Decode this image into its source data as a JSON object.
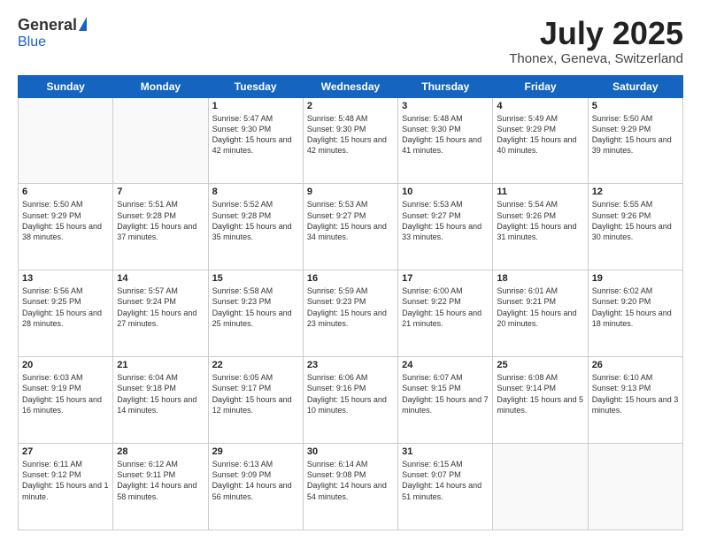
{
  "header": {
    "logo_general": "General",
    "logo_blue": "Blue",
    "title": "July 2025",
    "location": "Thonex, Geneva, Switzerland"
  },
  "days_of_week": [
    "Sunday",
    "Monday",
    "Tuesday",
    "Wednesday",
    "Thursday",
    "Friday",
    "Saturday"
  ],
  "weeks": [
    [
      {
        "day": "",
        "detail": ""
      },
      {
        "day": "",
        "detail": ""
      },
      {
        "day": "1",
        "detail": "Sunrise: 5:47 AM\nSunset: 9:30 PM\nDaylight: 15 hours\nand 42 minutes."
      },
      {
        "day": "2",
        "detail": "Sunrise: 5:48 AM\nSunset: 9:30 PM\nDaylight: 15 hours\nand 42 minutes."
      },
      {
        "day": "3",
        "detail": "Sunrise: 5:48 AM\nSunset: 9:30 PM\nDaylight: 15 hours\nand 41 minutes."
      },
      {
        "day": "4",
        "detail": "Sunrise: 5:49 AM\nSunset: 9:29 PM\nDaylight: 15 hours\nand 40 minutes."
      },
      {
        "day": "5",
        "detail": "Sunrise: 5:50 AM\nSunset: 9:29 PM\nDaylight: 15 hours\nand 39 minutes."
      }
    ],
    [
      {
        "day": "6",
        "detail": "Sunrise: 5:50 AM\nSunset: 9:29 PM\nDaylight: 15 hours\nand 38 minutes."
      },
      {
        "day": "7",
        "detail": "Sunrise: 5:51 AM\nSunset: 9:28 PM\nDaylight: 15 hours\nand 37 minutes."
      },
      {
        "day": "8",
        "detail": "Sunrise: 5:52 AM\nSunset: 9:28 PM\nDaylight: 15 hours\nand 35 minutes."
      },
      {
        "day": "9",
        "detail": "Sunrise: 5:53 AM\nSunset: 9:27 PM\nDaylight: 15 hours\nand 34 minutes."
      },
      {
        "day": "10",
        "detail": "Sunrise: 5:53 AM\nSunset: 9:27 PM\nDaylight: 15 hours\nand 33 minutes."
      },
      {
        "day": "11",
        "detail": "Sunrise: 5:54 AM\nSunset: 9:26 PM\nDaylight: 15 hours\nand 31 minutes."
      },
      {
        "day": "12",
        "detail": "Sunrise: 5:55 AM\nSunset: 9:26 PM\nDaylight: 15 hours\nand 30 minutes."
      }
    ],
    [
      {
        "day": "13",
        "detail": "Sunrise: 5:56 AM\nSunset: 9:25 PM\nDaylight: 15 hours\nand 28 minutes."
      },
      {
        "day": "14",
        "detail": "Sunrise: 5:57 AM\nSunset: 9:24 PM\nDaylight: 15 hours\nand 27 minutes."
      },
      {
        "day": "15",
        "detail": "Sunrise: 5:58 AM\nSunset: 9:23 PM\nDaylight: 15 hours\nand 25 minutes."
      },
      {
        "day": "16",
        "detail": "Sunrise: 5:59 AM\nSunset: 9:23 PM\nDaylight: 15 hours\nand 23 minutes."
      },
      {
        "day": "17",
        "detail": "Sunrise: 6:00 AM\nSunset: 9:22 PM\nDaylight: 15 hours\nand 21 minutes."
      },
      {
        "day": "18",
        "detail": "Sunrise: 6:01 AM\nSunset: 9:21 PM\nDaylight: 15 hours\nand 20 minutes."
      },
      {
        "day": "19",
        "detail": "Sunrise: 6:02 AM\nSunset: 9:20 PM\nDaylight: 15 hours\nand 18 minutes."
      }
    ],
    [
      {
        "day": "20",
        "detail": "Sunrise: 6:03 AM\nSunset: 9:19 PM\nDaylight: 15 hours\nand 16 minutes."
      },
      {
        "day": "21",
        "detail": "Sunrise: 6:04 AM\nSunset: 9:18 PM\nDaylight: 15 hours\nand 14 minutes."
      },
      {
        "day": "22",
        "detail": "Sunrise: 6:05 AM\nSunset: 9:17 PM\nDaylight: 15 hours\nand 12 minutes."
      },
      {
        "day": "23",
        "detail": "Sunrise: 6:06 AM\nSunset: 9:16 PM\nDaylight: 15 hours\nand 10 minutes."
      },
      {
        "day": "24",
        "detail": "Sunrise: 6:07 AM\nSunset: 9:15 PM\nDaylight: 15 hours\nand 7 minutes."
      },
      {
        "day": "25",
        "detail": "Sunrise: 6:08 AM\nSunset: 9:14 PM\nDaylight: 15 hours\nand 5 minutes."
      },
      {
        "day": "26",
        "detail": "Sunrise: 6:10 AM\nSunset: 9:13 PM\nDaylight: 15 hours\nand 3 minutes."
      }
    ],
    [
      {
        "day": "27",
        "detail": "Sunrise: 6:11 AM\nSunset: 9:12 PM\nDaylight: 15 hours\nand 1 minute."
      },
      {
        "day": "28",
        "detail": "Sunrise: 6:12 AM\nSunset: 9:11 PM\nDaylight: 14 hours\nand 58 minutes."
      },
      {
        "day": "29",
        "detail": "Sunrise: 6:13 AM\nSunset: 9:09 PM\nDaylight: 14 hours\nand 56 minutes."
      },
      {
        "day": "30",
        "detail": "Sunrise: 6:14 AM\nSunset: 9:08 PM\nDaylight: 14 hours\nand 54 minutes."
      },
      {
        "day": "31",
        "detail": "Sunrise: 6:15 AM\nSunset: 9:07 PM\nDaylight: 14 hours\nand 51 minutes."
      },
      {
        "day": "",
        "detail": ""
      },
      {
        "day": "",
        "detail": ""
      }
    ]
  ]
}
